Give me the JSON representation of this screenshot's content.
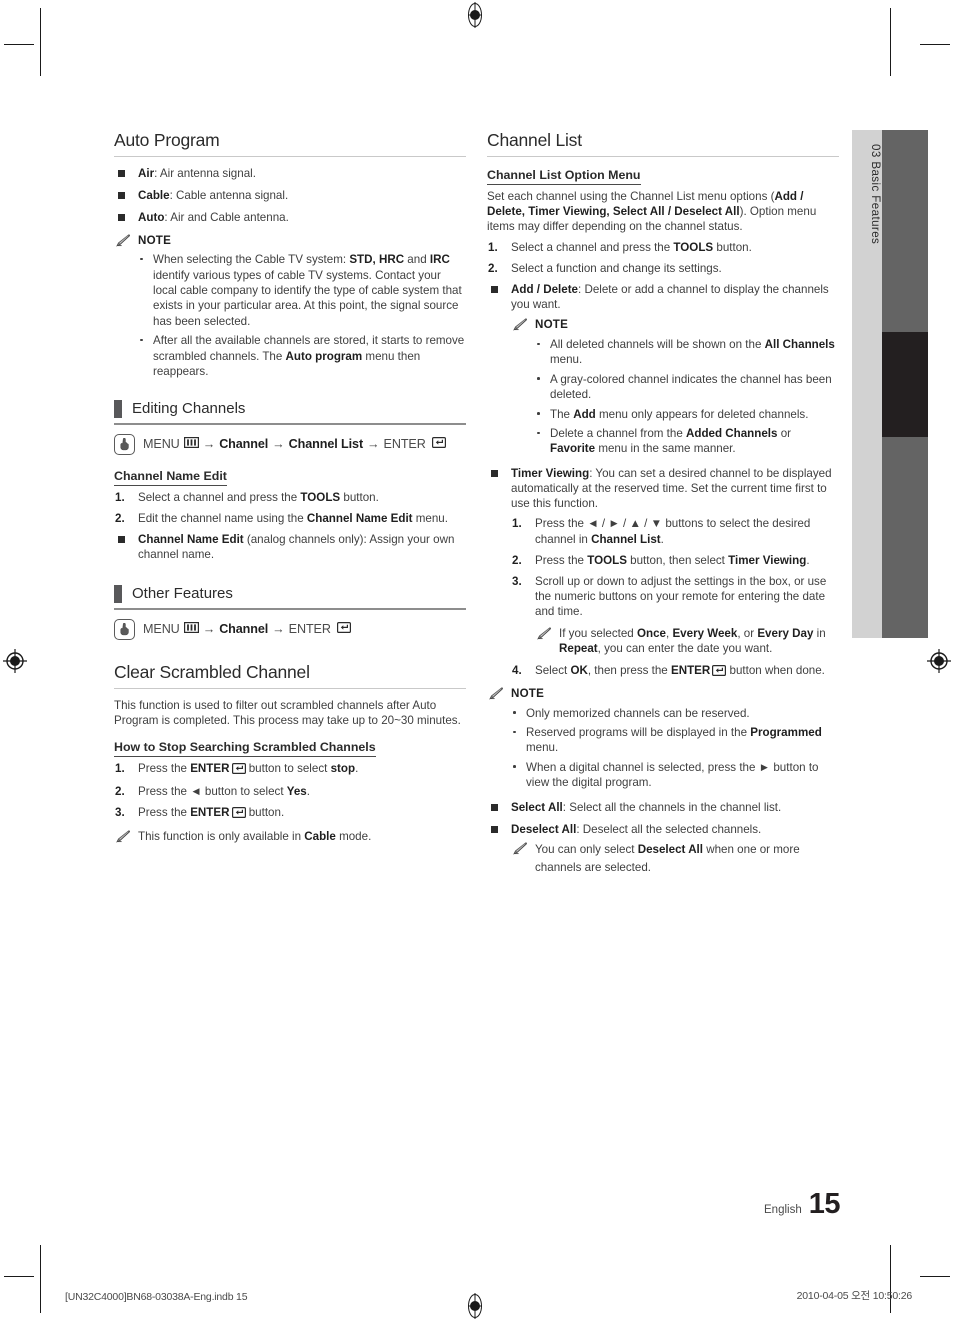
{
  "page": {
    "number": "15",
    "language": "English",
    "side_tab": "03  Basic Features"
  },
  "footer": {
    "left": "[UN32C4000]BN68-03038A-Eng.indb   15",
    "right": "2010-04-05   오전 10:50:26"
  },
  "left_column": {
    "auto_program": {
      "title": "Auto Program",
      "bullets": [
        {
          "term": "Air",
          "text": ": Air antenna signal."
        },
        {
          "term": "Cable",
          "text": ": Cable antenna signal."
        },
        {
          "term": "Auto",
          "text": ": Air and Cable antenna."
        }
      ],
      "note_label": "NOTE",
      "notes": [
        "When selecting the Cable TV system: STD, HRC and IRC identify various types of cable TV systems. Contact your local cable company to identify the type of cable system that exists in your particular area. At this point, the signal source has been selected.",
        "After all the available channels are stored, it starts to remove scrambled channels. The Auto program menu then reappears."
      ]
    },
    "editing_channels": {
      "title": "Editing Channels",
      "path": "MENU → Channel → Channel List → ENTER",
      "path_parts": {
        "menu": "MENU",
        "channel": "Channel",
        "channel_list": "Channel List",
        "enter": "ENTER"
      },
      "sub_title": "Channel Name Edit",
      "steps": [
        {
          "n": "1.",
          "text": "Select a channel and press the TOOLS button."
        },
        {
          "n": "2.",
          "text": "Edit the channel name using the Channel Name Edit menu."
        }
      ],
      "bullet": {
        "term": "Channel Name Edit",
        "text": " (analog channels only): Assign your own channel name."
      }
    },
    "other_features": {
      "title": "Other Features",
      "path_parts": {
        "menu": "MENU",
        "channel": "Channel",
        "enter": "ENTER"
      }
    },
    "clear_scrambled": {
      "title": "Clear Scrambled Channel",
      "intro": "This function is used to filter out scrambled channels after Auto Program is completed. This process may take up to 20~30 minutes.",
      "sub_title": "How to Stop Searching Scrambled Channels",
      "steps": [
        {
          "n": "1.",
          "text": "Press the ENTER button to select stop."
        },
        {
          "n": "2.",
          "text": "Press the ◄ button to select Yes."
        },
        {
          "n": "3.",
          "text": "Press the ENTER button."
        }
      ],
      "note": "This function is only available in Cable mode."
    }
  },
  "right_column": {
    "channel_list": {
      "title": "Channel List",
      "sub_title": "Channel List Option Menu",
      "intro_prefix": "Set each channel using the Channel List menu options (",
      "intro_bold": "Add / Delete, Timer Viewing, Select All / Deselect All",
      "intro_suffix": "). Option menu items may differ depending on the channel status.",
      "steps": [
        {
          "n": "1.",
          "text": "Select a channel and press the TOOLS button."
        },
        {
          "n": "2.",
          "text": "Select a function and change its settings."
        }
      ],
      "add_delete": {
        "term": "Add / Delete",
        "text": ": Delete or add a channel to display the channels you want.",
        "note_label": "NOTE",
        "notes": [
          "All deleted channels will be shown on the All Channels menu.",
          "A gray-colored channel indicates the channel has been deleted.",
          "The Add menu only appears for deleted channels.",
          "Delete a channel from the Added Channels or Favorite menu in the same manner."
        ]
      },
      "timer_viewing": {
        "term": "Timer Viewing",
        "text": ": You can set a desired channel to be displayed automatically at the reserved time. Set the current time first to use this function.",
        "steps": [
          {
            "n": "1.",
            "text": "Press the ◄ / ► / ▲ / ▼ buttons to select the desired channel in Channel List."
          },
          {
            "n": "2.",
            "text": "Press the TOOLS button, then select Timer Viewing."
          },
          {
            "n": "3.",
            "text": "Scroll up or down to adjust the settings in the box, or use the numeric buttons on your remote for entering the date and time."
          },
          {
            "n": "4.",
            "text": "Select OK, then press the ENTER button when done."
          }
        ],
        "inline_note": "If you selected Once, Every Week, or Every Day in Repeat, you can enter the date you want.",
        "note_label": "NOTE",
        "notes": [
          "Only memorized channels can be reserved.",
          "Reserved programs will be displayed in the Programmed menu.",
          "When a digital channel is selected, press the ► button to view the digital program."
        ]
      },
      "select_all": {
        "term": "Select All",
        "text": ": Select all the channels in the channel list."
      },
      "deselect_all": {
        "term": "Deselect All",
        "text": ": Deselect all the selected channels.",
        "note": "You can only select Deselect All when one or more channels are selected."
      }
    }
  },
  "icons": {
    "note_pencil": "pencil-icon",
    "hand": "hand-pointer-icon",
    "menu": "menu-grid-icon",
    "enter": "enter-return-icon",
    "reg_mark": "registration-target-icon"
  }
}
